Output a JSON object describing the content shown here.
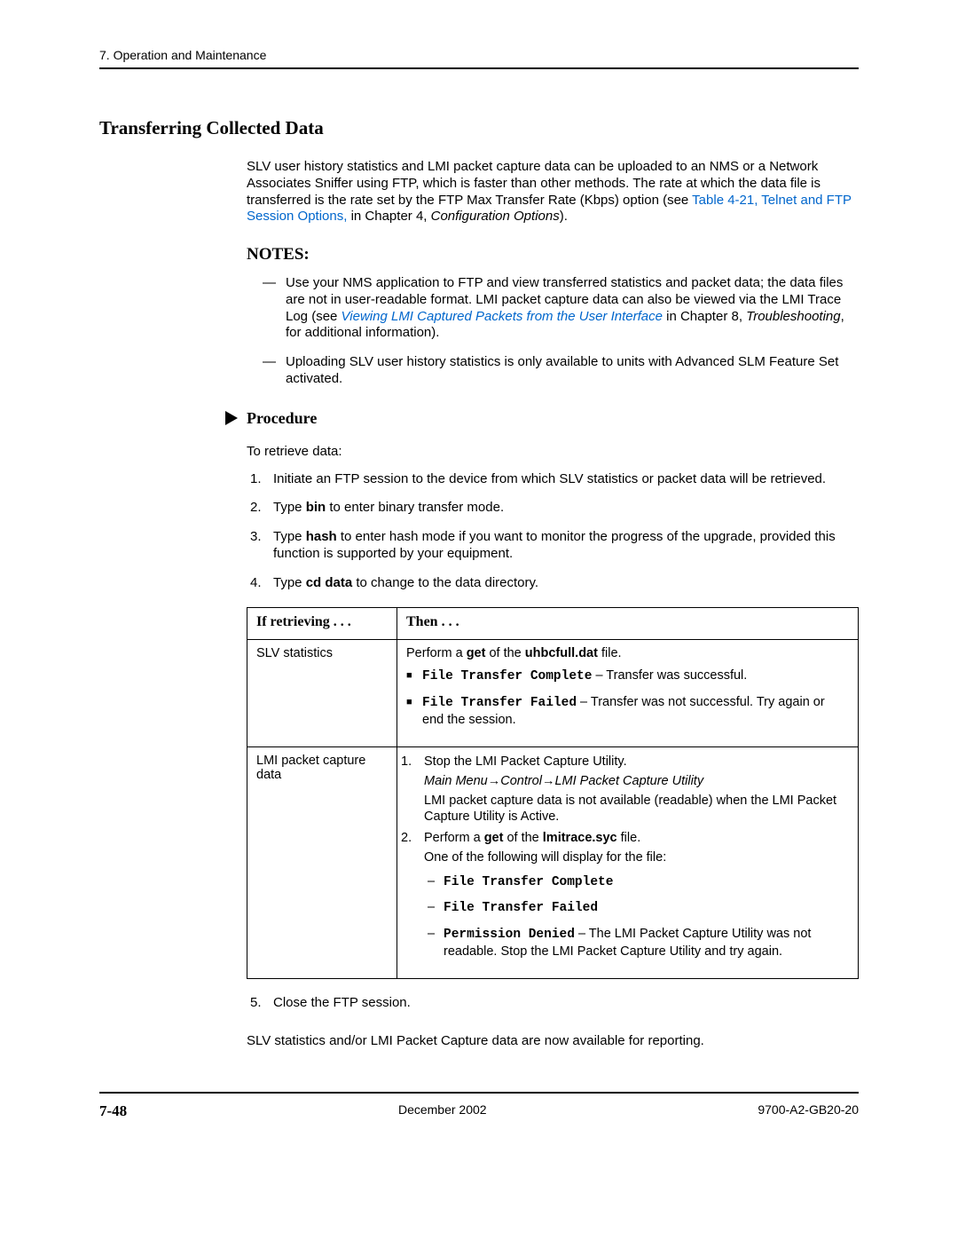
{
  "header": {
    "chapter": "7. Operation and Maintenance"
  },
  "section_title": "Transferring Collected Data",
  "intro": {
    "p1a": "SLV user history statistics and LMI packet capture data can be uploaded to an NMS or a Network Associates Sniffer using FTP, which is faster than other methods. The rate at which the data file is transferred is the rate set by the FTP Max Transfer Rate (Kbps) option (see ",
    "p1_link": "Table 4-21, Telnet and FTP Session Options,",
    "p1b": " in Chapter 4, ",
    "p1_ital": "Configuration Options",
    "p1c": ")."
  },
  "notes_heading": "NOTES:",
  "notes": [
    {
      "a": "Use your NMS application to FTP and view transferred statistics and packet data; the data files are not in user-readable format. LMI packet capture data can also be viewed via the LMI Trace Log (see ",
      "link": "Viewing LMI Captured Packets from the User Interface",
      "b": " in Chapter 8, ",
      "ital": "Troubleshooting",
      "c": ", for additional information)."
    },
    {
      "a": "Uploading SLV user history statistics is only available to units with Advanced SLM Feature Set activated."
    }
  ],
  "procedure_label": "Procedure",
  "proc_intro": "To retrieve data:",
  "steps": {
    "s1": "Initiate an FTP session to the device from which SLV statistics or packet data will be retrieved.",
    "s2a": "Type ",
    "s2b": "bin",
    "s2c": " to enter binary transfer mode.",
    "s3a": "Type ",
    "s3b": "hash",
    "s3c": " to enter hash mode if you want to monitor the progress of the upgrade, provided this function is supported by your equipment.",
    "s4a": "Type ",
    "s4b": "cd data",
    "s4c": " to change to the data directory.",
    "s5": "Close the FTP session."
  },
  "table": {
    "head_if": "If retrieving . . .",
    "head_then": "Then . . .",
    "row1": {
      "if": "SLV statistics",
      "then_a": "Perform a ",
      "then_get": "get",
      "then_b": " of the ",
      "then_file": "uhbcfull.dat",
      "then_c": " file.",
      "b1a": "File Transfer Complete",
      "b1b": " – Transfer was successful.",
      "b2a": "File Transfer Failed",
      "b2b": " – Transfer was not successful. Try again or end the session."
    },
    "row2": {
      "if": "LMI packet capture data",
      "s1": "Stop the LMI Packet Capture Utility.",
      "menu": "Main Menu→Control→LMI Packet Capture Utility",
      "s1b": "LMI packet capture data is not available (readable) when the LMI Packet Capture Utility is Active.",
      "s2a": "Perform a ",
      "s2get": "get",
      "s2b": " of the ",
      "s2file": "lmitrace.syc",
      "s2c": " file.",
      "s2d": "One of the following will display for the file:",
      "d1": "File Transfer Complete",
      "d2": "File Transfer Failed",
      "d3a": "Permission Denied",
      "d3b": " – The LMI Packet Capture Utility was not readable. Stop the LMI Packet Capture Utility and try again."
    }
  },
  "closing": "SLV statistics and/or LMI Packet Capture data are now available for reporting.",
  "footer": {
    "page": "7-48",
    "date": "December 2002",
    "docnum": "9700-A2-GB20-20"
  }
}
